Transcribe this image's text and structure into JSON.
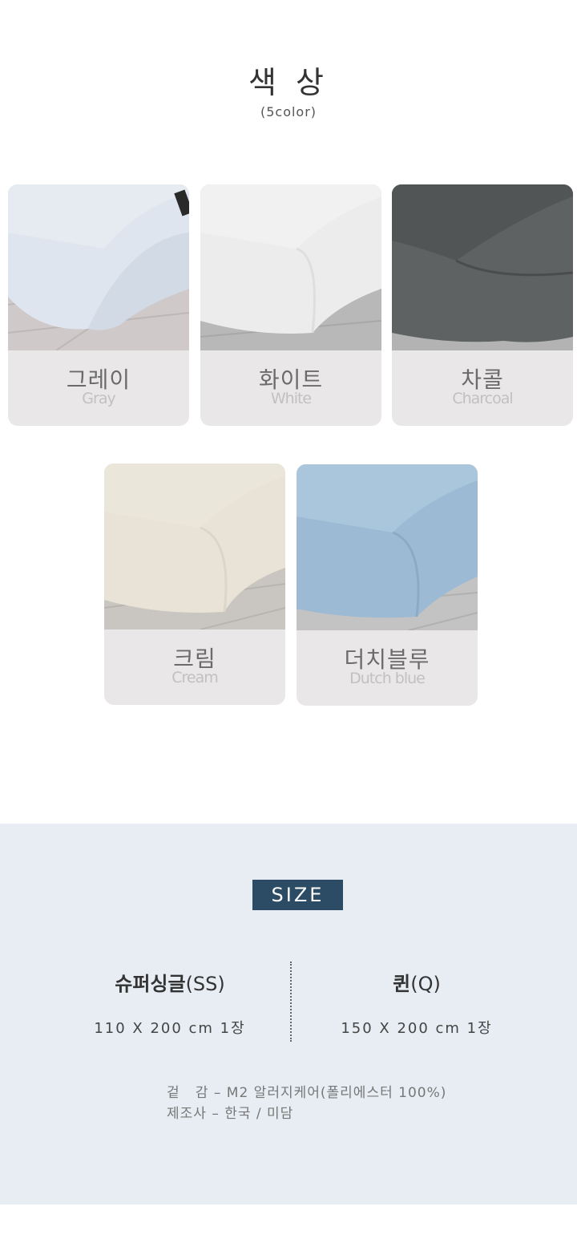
{
  "header": {
    "title": "색 상",
    "subtitle": "(5color)"
  },
  "colors": [
    {
      "ko": "그레이",
      "en": "Gray",
      "swatch": "#dde3ec"
    },
    {
      "ko": "화이트",
      "en": "White",
      "swatch": "#ebebeb"
    },
    {
      "ko": "차콜",
      "en": "Charcoal",
      "swatch": "#5a5d5e"
    },
    {
      "ko": "크림",
      "en": "Cream",
      "swatch": "#e6e1d4"
    },
    {
      "ko": "더치블루",
      "en": "Dutch blue",
      "swatch": "#9bbad3"
    }
  ],
  "size": {
    "badge": "SIZE",
    "ss": {
      "name": "슈퍼싱글",
      "code": "(SS)",
      "dims": "110 X 200 cm 1장"
    },
    "q": {
      "name": "퀸",
      "code": "(Q)",
      "dims": "150 X 200 cm 1장"
    },
    "material": "겉   감 – M2 알러지케어(폴리에스터 100%)",
    "maker": "제조사 – 한국 / 미담"
  },
  "palette": {
    "card_bg": "#e9e7e8",
    "size_bg": "#e7edf3",
    "badge_bg": "#2b4c64"
  }
}
